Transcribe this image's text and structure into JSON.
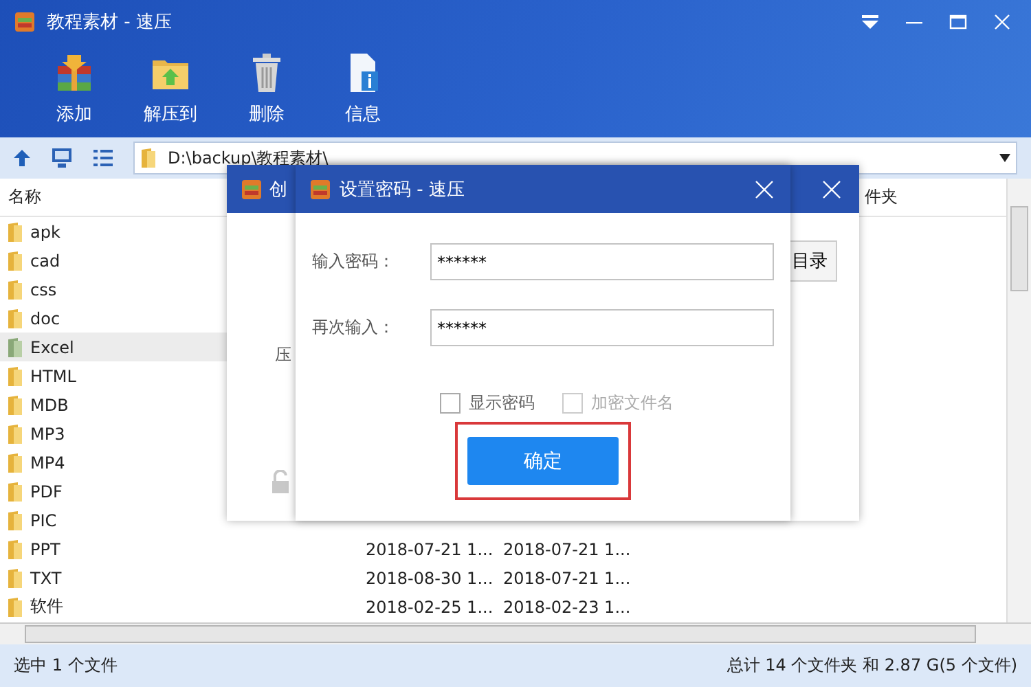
{
  "window": {
    "title": "教程素材 - 速压"
  },
  "toolbar": [
    {
      "label": "添加",
      "kind": "add"
    },
    {
      "label": "解压到",
      "kind": "extract"
    },
    {
      "label": "删除",
      "kind": "delete"
    },
    {
      "label": "信息",
      "kind": "info"
    }
  ],
  "address": {
    "path": "D:\\backup\\教程素材\\"
  },
  "file_list": {
    "columns": [
      "名称",
      "件夹"
    ],
    "rows": [
      {
        "name": "apk",
        "selected": false
      },
      {
        "name": "cad",
        "selected": false
      },
      {
        "name": "css",
        "selected": false
      },
      {
        "name": "doc",
        "selected": false
      },
      {
        "name": "Excel",
        "selected": true
      },
      {
        "name": "HTML",
        "selected": false
      },
      {
        "name": "MDB",
        "selected": false
      },
      {
        "name": "MP3",
        "selected": false
      },
      {
        "name": "MP4",
        "selected": false
      },
      {
        "name": "PDF",
        "selected": false
      },
      {
        "name": "PIC",
        "selected": false
      },
      {
        "name": "PPT",
        "selected": false,
        "modified": "2018-07-21 1...",
        "created": "2018-07-21 1..."
      },
      {
        "name": "TXT",
        "selected": false,
        "modified": "2018-08-30 1...",
        "created": "2018-07-21 1..."
      },
      {
        "name": "软件",
        "selected": false,
        "modified": "2018-02-25 1...",
        "created": "2018-02-23 1..."
      }
    ]
  },
  "back_dialog": {
    "title": "创",
    "label": "压",
    "button": "目录"
  },
  "password_dialog": {
    "title": "设置密码 - 速压",
    "fields": [
      {
        "label": "输入密码：",
        "value": "******"
      },
      {
        "label": "再次输入：",
        "value": "******"
      }
    ],
    "options": [
      {
        "label": "显示密码",
        "checked": false,
        "disabled": false
      },
      {
        "label": "加密文件名",
        "checked": false,
        "disabled": true
      }
    ],
    "confirm": "确定",
    "highlighted": true
  },
  "status_bar": {
    "left": "选中 1 个文件",
    "right": "总计 14 个文件夹 和 2.87 G(5 个文件)"
  }
}
